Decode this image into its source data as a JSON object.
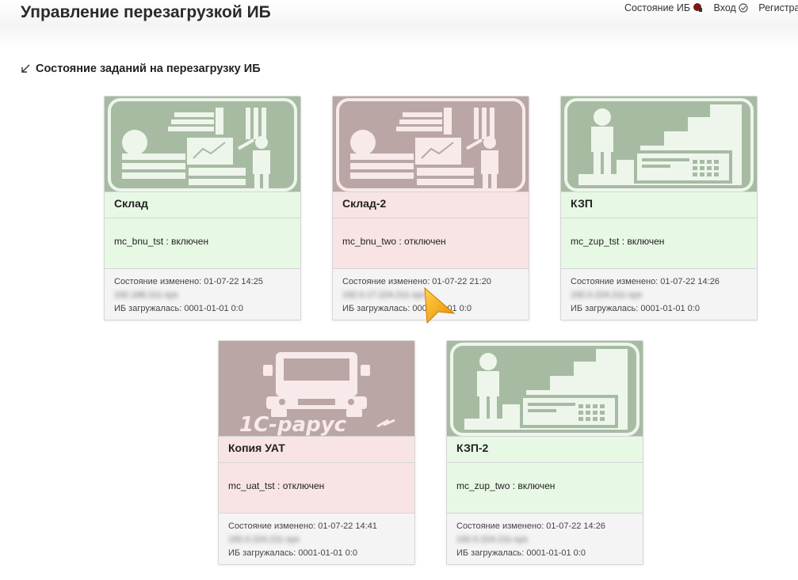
{
  "app_title": "Управление перезагрузкой ИБ",
  "nav": {
    "state_label": "Состояние ИБ",
    "login_label": "Вход",
    "register_label": "Регистрация"
  },
  "section": {
    "title": "Состояние заданий на перезагрузку ИБ"
  },
  "colors": {
    "enabled_bg": "#e7f8e4",
    "disabled_bg": "#f8e4e4",
    "enabled_icon_bg": "#a7bba3",
    "disabled_icon_bg": "#bba6a6"
  },
  "cards": [
    {
      "title": "Склад",
      "status": "mc_bnu_tst : включен",
      "changed": "Состояние изменено:  01-07-22 14:25",
      "host": "192.168.211-sys",
      "loaded": "ИБ загружалась:  0001-01-01 0:0",
      "image": "factory-icon",
      "state": "on"
    },
    {
      "title": "Склад-2",
      "status": "mc_bnu_two : отключен",
      "changed": "Состояние изменено:  01-07-22 21:20",
      "host": "192.0.17.224.211-sys",
      "loaded": "ИБ загружалась:  0001-01-01 0:0",
      "image": "factory-icon",
      "state": "off"
    },
    {
      "title": "КЗП",
      "status": "mc_zup_tst : включен",
      "changed": "Состояние изменено:  01-07-22 14:26",
      "host": "192.0.224.211-sys",
      "loaded": "ИБ загружалась:  0001-01-01 0:0",
      "image": "career-stairs-icon",
      "state": "on"
    },
    {
      "title": "Копия УАТ",
      "status": "mc_uat_tst : отключен",
      "changed": "Состояние изменено:  01-07-22 14:41",
      "host": "192.0.224.211-sys",
      "loaded": "ИБ загружалась:  0001-01-01 0:0",
      "image": "truck-icon",
      "logo": "1С-рарус",
      "state": "off"
    },
    {
      "title": "КЗП-2",
      "status": "mc_zup_two : включен",
      "changed": "Состояние изменено:  01-07-22 14:26",
      "host": "192.0.224.211-sys",
      "loaded": "ИБ загружалась:  0001-01-01 0:0",
      "image": "career-stairs-icon",
      "state": "on"
    }
  ]
}
